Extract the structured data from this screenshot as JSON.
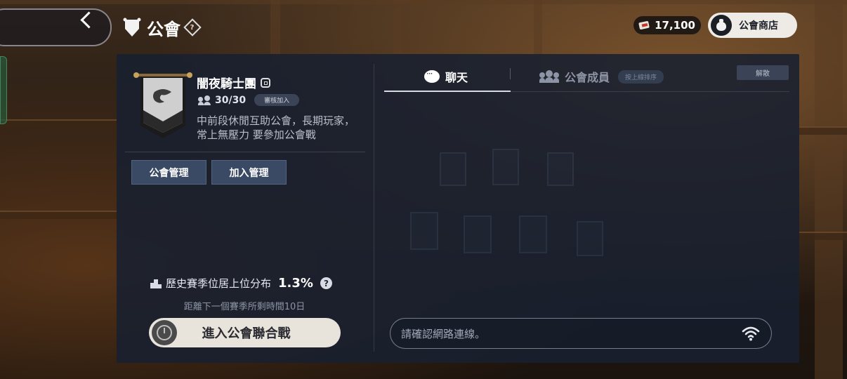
{
  "header": {
    "title": "公會",
    "help_glyph": "?",
    "currency_value": "17,100",
    "shop_label": "公會商店"
  },
  "guild": {
    "name": "闇夜騎士團",
    "member_count": "30/30",
    "join_badge": "審核加入",
    "description": "中前段休閒互助公會，長期玩家，常上無壓力 要參加公會戰",
    "buttons": {
      "manage": "公會管理",
      "join_manage": "加入管理"
    },
    "season": {
      "rank_label": "歷史賽季位居上位分布",
      "rank_value": "1.3%",
      "help_glyph": "?",
      "timer": "距離下一個賽季所剩時間10日"
    },
    "war_button": "進入公會聯合戰"
  },
  "tabs": [
    {
      "label": "聊天",
      "active": true
    },
    {
      "label": "公會成員",
      "active": false,
      "sort_chip": "按上線排序"
    }
  ],
  "disband_label": "解散",
  "chat": {
    "placeholder": "請確認網路連線。"
  },
  "colors": {
    "panel_bg": "#18202f",
    "button_bg": "#3a4a64",
    "war_button_bg": "#e8e4dc"
  }
}
